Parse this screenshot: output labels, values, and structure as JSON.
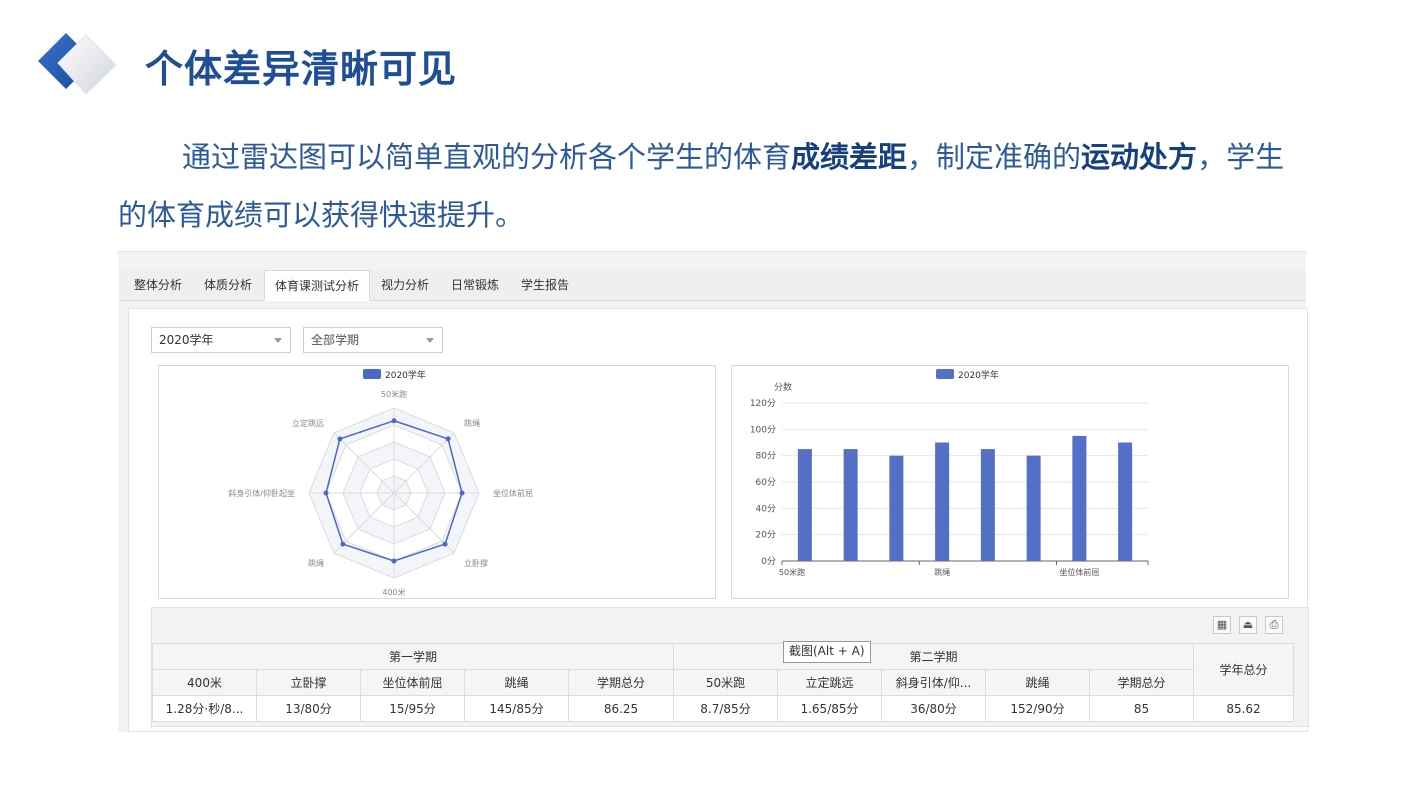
{
  "page": {
    "title": "个体差异清晰可见",
    "intro": {
      "p1": "通过雷达图可以简单直观的分析各个学生的体育",
      "b1": "成绩差距",
      "p2": "，制定准确的",
      "b2": "运动处方",
      "p3": "，学生的体育成绩可以获得快速提升。"
    },
    "accent_color": "#1f4e96"
  },
  "tabs": [
    {
      "label": "整体分析",
      "active": false
    },
    {
      "label": "体质分析",
      "active": false
    },
    {
      "label": "体育课测试分析",
      "active": true
    },
    {
      "label": "视力分析",
      "active": false
    },
    {
      "label": "日常锻炼",
      "active": false
    },
    {
      "label": "学生报告",
      "active": false
    }
  ],
  "filters": {
    "year": "2020学年",
    "term": "全部学期"
  },
  "toolbar": {
    "tooltip": "截图(Alt + A)",
    "icons": [
      "grid-icon",
      "export-icon",
      "print-icon"
    ]
  },
  "chart_data": [
    {
      "type": "radar",
      "legend": [
        "2020学年"
      ],
      "indicators": [
        "50米跑",
        "跳绳",
        "坐位体前屈",
        "立卧撑",
        "400米",
        "跳绳",
        "斜身引体/仰卧起坐",
        "立定跳远"
      ],
      "series": [
        {
          "name": "2020学年",
          "values": [
            85,
            90,
            80,
            85,
            80,
            85,
            80,
            90
          ]
        }
      ],
      "max": 100,
      "color": "#4a68c4"
    },
    {
      "type": "bar",
      "legend": [
        "2020学年"
      ],
      "ylabel": "分数",
      "ylim": [
        0,
        120
      ],
      "yticks": [
        "0分",
        "20分",
        "40分",
        "60分",
        "80分",
        "100分",
        "120分"
      ],
      "categories": [
        "50米跑",
        "",
        "",
        "跳绳",
        "",
        "",
        "坐位体前屈",
        ""
      ],
      "xtick_labels": [
        "50米跑",
        "跳绳",
        "坐位体前屈"
      ],
      "series": [
        {
          "name": "2020学年",
          "values": [
            85,
            85,
            80,
            90,
            85,
            80,
            95,
            90
          ]
        }
      ],
      "color": "#5470c6"
    }
  ],
  "table": {
    "group1": "第一学期",
    "group2": "第二学期",
    "year_total": "学年总分",
    "headers1": [
      "400米",
      "立卧撑",
      "坐位体前屈",
      "跳绳",
      "学期总分"
    ],
    "headers2": [
      "50米跑",
      "立定跳远",
      "斜身引体/仰...",
      "跳绳",
      "学期总分"
    ],
    "row": [
      "1.28分·秒/8...",
      "13/80分",
      "15/95分",
      "145/85分",
      "86.25",
      "8.7/85分",
      "1.65/85分",
      "36/80分",
      "152/90分",
      "85",
      "85.62"
    ]
  }
}
